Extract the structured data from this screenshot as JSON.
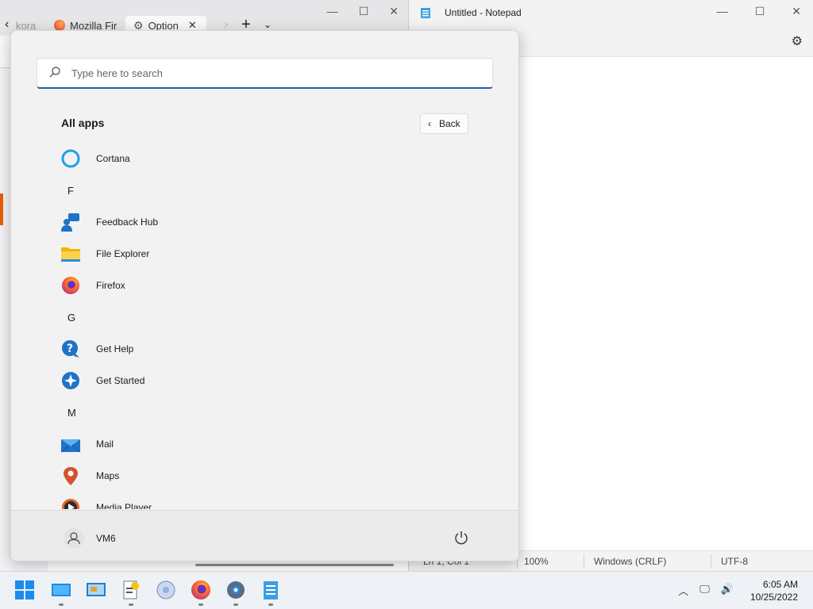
{
  "firefox": {
    "tabs": [
      {
        "label": "kora"
      },
      {
        "label": "Mozilla Fir"
      },
      {
        "label": "Option"
      }
    ]
  },
  "notepad": {
    "title": "Untitled - Notepad",
    "status": {
      "position": "Ln 1, Col 1",
      "zoom": "100%",
      "line_ending": "Windows (CRLF)",
      "encoding": "UTF-8"
    }
  },
  "start_menu": {
    "search_placeholder": "Type here to search",
    "heading": "All apps",
    "back_label": "Back",
    "items": [
      {
        "type": "app",
        "label": "Cortana",
        "icon": "cortana-icon"
      },
      {
        "type": "letter",
        "label": "F"
      },
      {
        "type": "app",
        "label": "Feedback Hub",
        "icon": "feedback-hub-icon"
      },
      {
        "type": "app",
        "label": "File Explorer",
        "icon": "file-explorer-icon"
      },
      {
        "type": "app",
        "label": "Firefox",
        "icon": "firefox-icon"
      },
      {
        "type": "letter",
        "label": "G"
      },
      {
        "type": "app",
        "label": "Get Help",
        "icon": "get-help-icon"
      },
      {
        "type": "app",
        "label": "Get Started",
        "icon": "get-started-icon"
      },
      {
        "type": "letter",
        "label": "M"
      },
      {
        "type": "app",
        "label": "Mail",
        "icon": "mail-icon"
      },
      {
        "type": "app",
        "label": "Maps",
        "icon": "maps-icon"
      },
      {
        "type": "app",
        "label": "Media Player",
        "icon": "media-player-icon"
      }
    ],
    "user": "VM6"
  },
  "taskbar": {
    "time": "6:05 AM",
    "date": "10/25/2022"
  }
}
